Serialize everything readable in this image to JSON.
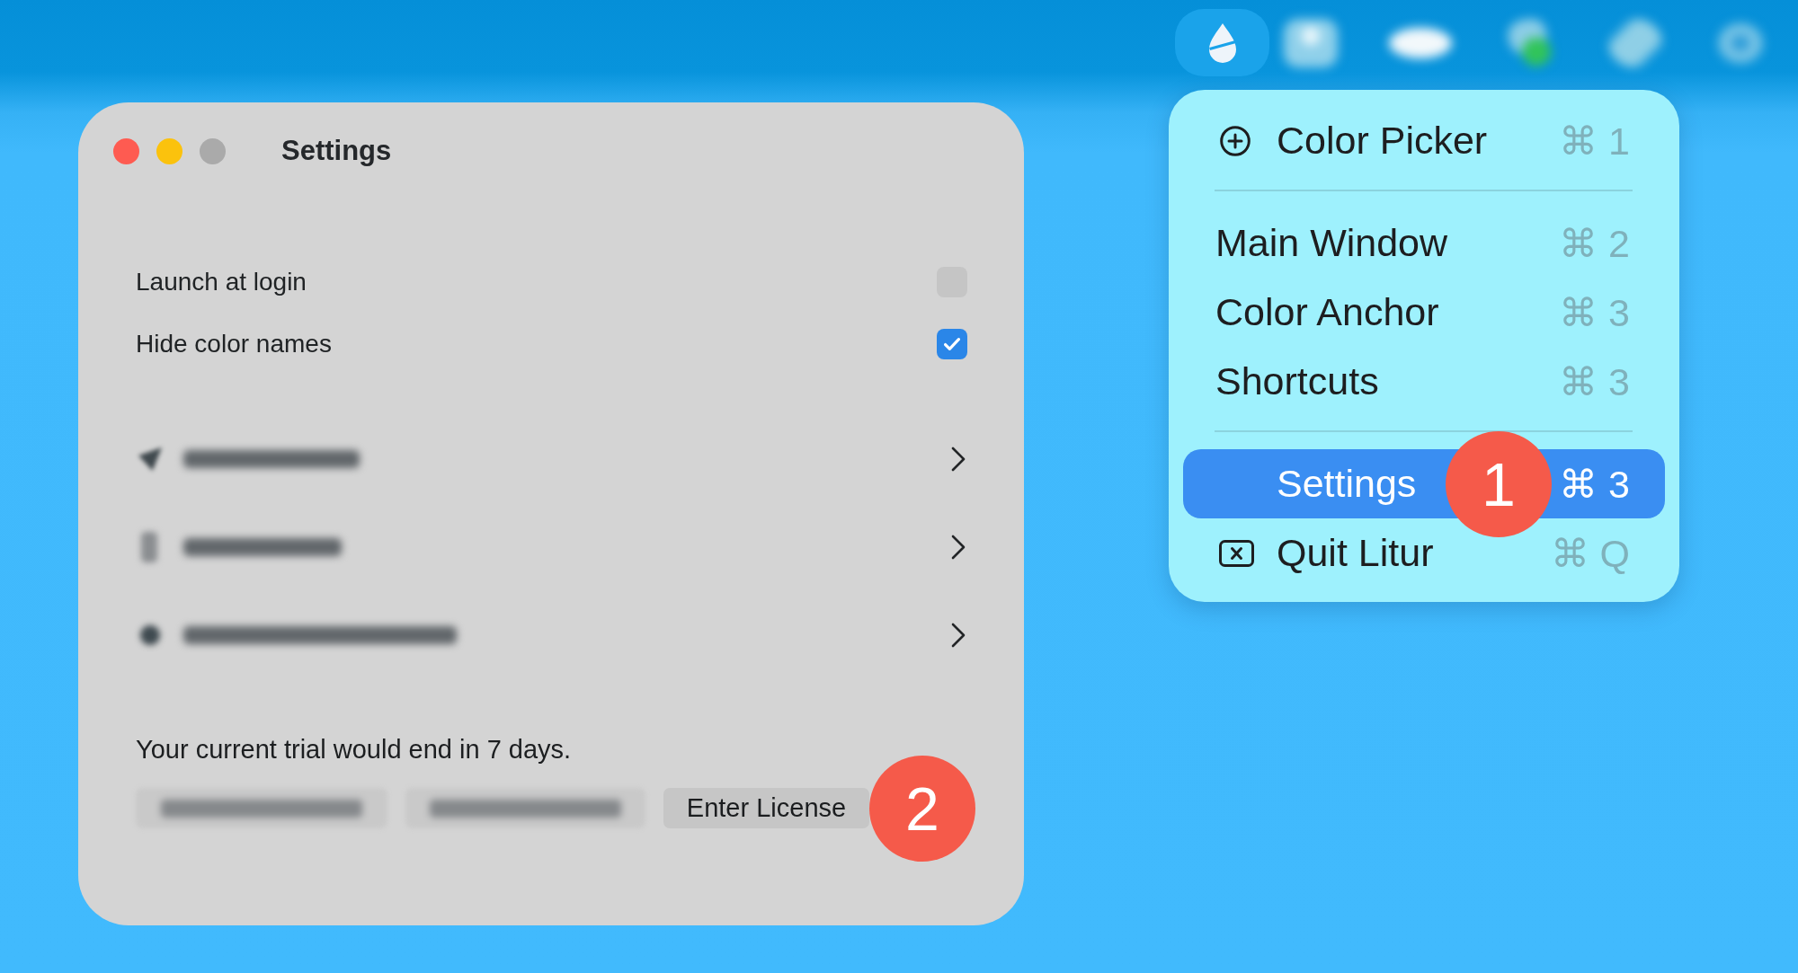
{
  "menubar": [
    {
      "kind": "app",
      "selected": true
    },
    {
      "kind": "blurred",
      "selected": false
    },
    {
      "kind": "blurred",
      "selected": false
    },
    {
      "kind": "blurred",
      "selected": false
    },
    {
      "kind": "blurred",
      "selected": false
    },
    {
      "kind": "blurred",
      "selected": false
    }
  ],
  "settings_window": {
    "title": "Settings",
    "options": [
      {
        "label": "Launch at login",
        "checked": false
      },
      {
        "label": "Hide color names",
        "checked": true
      }
    ],
    "links": [
      {
        "kind": "blurred"
      },
      {
        "kind": "blurred"
      },
      {
        "kind": "blurred"
      }
    ],
    "trial_notice": "Your current trial would end in 7 days.",
    "license_buttons": [
      {
        "kind": "blurred"
      },
      {
        "kind": "blurred"
      },
      {
        "kind": "button",
        "label": "Enter License",
        "callout": "2"
      }
    ]
  },
  "menu": {
    "groups": [
      [
        {
          "kind": "tool",
          "label": "Color Picker",
          "shortcut": "⌘ 1",
          "selected": false
        }
      ],
      [
        {
          "kind": "plain",
          "label": "Main Window",
          "shortcut": "⌘ 2",
          "selected": false
        },
        {
          "kind": "plain",
          "label": "Color Anchor",
          "shortcut": "⌘ 3",
          "selected": false
        },
        {
          "kind": "plain",
          "label": "Shortcuts",
          "shortcut": "⌘ 3",
          "selected": false
        }
      ],
      [
        {
          "kind": "indented",
          "label": "Settings",
          "shortcut": "⌘ 3",
          "selected": true,
          "callout": "1"
        },
        {
          "kind": "quit",
          "label": "Quit Litur",
          "shortcut": "⌘ Q",
          "selected": false
        }
      ]
    ]
  }
}
